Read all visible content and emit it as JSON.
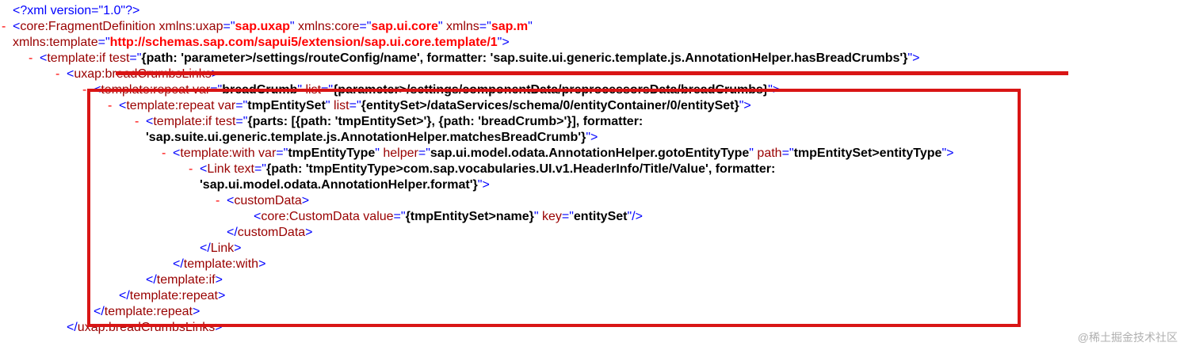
{
  "toggle_symbol": "-",
  "lines": [
    {
      "indent": 16,
      "toggle": false,
      "segments": [
        {
          "cls": "d",
          "text": "<?xml version=\"1.0\"?>"
        }
      ]
    },
    {
      "indent": 16,
      "toggle": true,
      "segments": [
        {
          "cls": "d",
          "text": "<"
        },
        {
          "cls": "t",
          "text": "core:FragmentDefinition"
        },
        {
          "cls": "an",
          "text": " xmlns:uxap"
        },
        {
          "cls": "d",
          "text": "=\""
        },
        {
          "cls": "avr",
          "text": "sap.uxap"
        },
        {
          "cls": "d",
          "text": "\""
        },
        {
          "cls": "an",
          "text": " xmlns:core"
        },
        {
          "cls": "d",
          "text": "=\""
        },
        {
          "cls": "avr",
          "text": "sap.ui.core"
        },
        {
          "cls": "d",
          "text": "\""
        },
        {
          "cls": "an",
          "text": " xmlns"
        },
        {
          "cls": "d",
          "text": "=\""
        },
        {
          "cls": "avr",
          "text": "sap.m"
        },
        {
          "cls": "d",
          "text": "\""
        }
      ]
    },
    {
      "indent": 16,
      "toggle": false,
      "segments": [
        {
          "cls": "an",
          "text": "xmlns:template"
        },
        {
          "cls": "d",
          "text": "=\""
        },
        {
          "cls": "avr",
          "text": "http://schemas.sap.com/sapui5/extension/sap.ui.core.template/1"
        },
        {
          "cls": "d",
          "text": "\">"
        }
      ]
    },
    {
      "indent": 50,
      "toggle": true,
      "segments": [
        {
          "cls": "d",
          "text": "<"
        },
        {
          "cls": "t",
          "text": "template:if"
        },
        {
          "cls": "an",
          "text": " test"
        },
        {
          "cls": "d",
          "text": "=\""
        },
        {
          "cls": "av",
          "text": "{path: 'parameter>/settings/routeConfig/name', formatter: 'sap.suite.ui.generic.template.js.AnnotationHelper.hasBreadCrumbs'}"
        },
        {
          "cls": "d",
          "text": "\">"
        }
      ]
    },
    {
      "indent": 84,
      "toggle": true,
      "segments": [
        {
          "cls": "d",
          "text": "<"
        },
        {
          "cls": "t",
          "text": "uxap:breadCrumbsLinks"
        },
        {
          "cls": "d",
          "text": ">"
        }
      ]
    },
    {
      "indent": 118,
      "toggle": true,
      "segments": [
        {
          "cls": "d",
          "text": "<"
        },
        {
          "cls": "t",
          "text": "template:repeat"
        },
        {
          "cls": "an",
          "text": " var"
        },
        {
          "cls": "d",
          "text": "=\""
        },
        {
          "cls": "av",
          "text": "breadCrumb"
        },
        {
          "cls": "d",
          "text": "\""
        },
        {
          "cls": "an",
          "text": " list"
        },
        {
          "cls": "d",
          "text": "=\""
        },
        {
          "cls": "av",
          "text": "{parameter>/settings/componentData/preprocessorsData/breadCrumbs}"
        },
        {
          "cls": "d",
          "text": "\">"
        }
      ]
    },
    {
      "indent": 150,
      "toggle": true,
      "segments": [
        {
          "cls": "d",
          "text": "<"
        },
        {
          "cls": "t",
          "text": "template:repeat"
        },
        {
          "cls": "an",
          "text": " var"
        },
        {
          "cls": "d",
          "text": "=\""
        },
        {
          "cls": "av",
          "text": "tmpEntitySet"
        },
        {
          "cls": "d",
          "text": "\""
        },
        {
          "cls": "an",
          "text": " list"
        },
        {
          "cls": "d",
          "text": "=\""
        },
        {
          "cls": "av",
          "text": "{entitySet>/dataServices/schema/0/entityContainer/0/entitySet}"
        },
        {
          "cls": "d",
          "text": "\">"
        }
      ]
    },
    {
      "indent": 184,
      "toggle": true,
      "segments": [
        {
          "cls": "d",
          "text": "<"
        },
        {
          "cls": "t",
          "text": "template:if"
        },
        {
          "cls": "an",
          "text": " test"
        },
        {
          "cls": "d",
          "text": "=\""
        },
        {
          "cls": "av",
          "text": "{parts: [{path: 'tmpEntitySet>'}, {path: 'breadCrumb>'}], formatter:"
        }
      ]
    },
    {
      "indent": 184,
      "toggle": false,
      "segments": [
        {
          "cls": "av",
          "text": "'sap.suite.ui.generic.template.js.AnnotationHelper.matchesBreadCrumb'}"
        },
        {
          "cls": "d",
          "text": "\">"
        }
      ]
    },
    {
      "indent": 218,
      "toggle": true,
      "segments": [
        {
          "cls": "d",
          "text": "<"
        },
        {
          "cls": "t",
          "text": "template:with"
        },
        {
          "cls": "an",
          "text": " var"
        },
        {
          "cls": "d",
          "text": "=\""
        },
        {
          "cls": "av",
          "text": "tmpEntityType"
        },
        {
          "cls": "d",
          "text": "\""
        },
        {
          "cls": "an",
          "text": " helper"
        },
        {
          "cls": "d",
          "text": "=\""
        },
        {
          "cls": "av",
          "text": "sap.ui.model.odata.AnnotationHelper.gotoEntityType"
        },
        {
          "cls": "d",
          "text": "\""
        },
        {
          "cls": "an",
          "text": " path"
        },
        {
          "cls": "d",
          "text": "=\""
        },
        {
          "cls": "av",
          "text": "tmpEntitySet>entityType"
        },
        {
          "cls": "d",
          "text": "\">"
        }
      ]
    },
    {
      "indent": 252,
      "toggle": true,
      "segments": [
        {
          "cls": "d",
          "text": "<"
        },
        {
          "cls": "t",
          "text": "Link"
        },
        {
          "cls": "an",
          "text": " text"
        },
        {
          "cls": "d",
          "text": "=\""
        },
        {
          "cls": "av",
          "text": "{path: 'tmpEntityType>com.sap.vocabularies.UI.v1.HeaderInfo/Title/Value', formatter:"
        }
      ]
    },
    {
      "indent": 252,
      "toggle": false,
      "segments": [
        {
          "cls": "av",
          "text": "'sap.ui.model.odata.AnnotationHelper.format'}"
        },
        {
          "cls": "d",
          "text": "\">"
        }
      ]
    },
    {
      "indent": 286,
      "toggle": true,
      "segments": [
        {
          "cls": "d",
          "text": "<"
        },
        {
          "cls": "t",
          "text": "customData"
        },
        {
          "cls": "d",
          "text": ">"
        }
      ]
    },
    {
      "indent": 320,
      "toggle": false,
      "segments": [
        {
          "cls": "d",
          "text": "<"
        },
        {
          "cls": "t",
          "text": "core:CustomData"
        },
        {
          "cls": "an",
          "text": " value"
        },
        {
          "cls": "d",
          "text": "=\""
        },
        {
          "cls": "av",
          "text": "{tmpEntitySet>name}"
        },
        {
          "cls": "d",
          "text": "\""
        },
        {
          "cls": "an",
          "text": " key"
        },
        {
          "cls": "d",
          "text": "=\""
        },
        {
          "cls": "av",
          "text": "entitySet"
        },
        {
          "cls": "d",
          "text": "\"/>"
        }
      ]
    },
    {
      "indent": 286,
      "toggle": false,
      "segments": [
        {
          "cls": "d",
          "text": "</"
        },
        {
          "cls": "t",
          "text": "customData"
        },
        {
          "cls": "d",
          "text": ">"
        }
      ]
    },
    {
      "indent": 252,
      "toggle": false,
      "segments": [
        {
          "cls": "d",
          "text": "</"
        },
        {
          "cls": "t",
          "text": "Link"
        },
        {
          "cls": "d",
          "text": ">"
        }
      ]
    },
    {
      "indent": 218,
      "toggle": false,
      "segments": [
        {
          "cls": "d",
          "text": "</"
        },
        {
          "cls": "t",
          "text": "template:with"
        },
        {
          "cls": "d",
          "text": ">"
        }
      ]
    },
    {
      "indent": 184,
      "toggle": false,
      "segments": [
        {
          "cls": "d",
          "text": "</"
        },
        {
          "cls": "t",
          "text": "template:if"
        },
        {
          "cls": "d",
          "text": ">"
        }
      ]
    },
    {
      "indent": 150,
      "toggle": false,
      "segments": [
        {
          "cls": "d",
          "text": "</"
        },
        {
          "cls": "t",
          "text": "template:repeat"
        },
        {
          "cls": "d",
          "text": ">"
        }
      ]
    },
    {
      "indent": 118,
      "toggle": false,
      "segments": [
        {
          "cls": "d",
          "text": "</"
        },
        {
          "cls": "t",
          "text": "template:repeat"
        },
        {
          "cls": "d",
          "text": ">"
        }
      ]
    },
    {
      "indent": 84,
      "toggle": false,
      "segments": [
        {
          "cls": "d",
          "text": "</"
        },
        {
          "cls": "t",
          "text": "uxap:breadCrumbsLinks"
        },
        {
          "cls": "d",
          "text": ">"
        }
      ]
    }
  ],
  "watermark": "@稀土掘金技术社区"
}
